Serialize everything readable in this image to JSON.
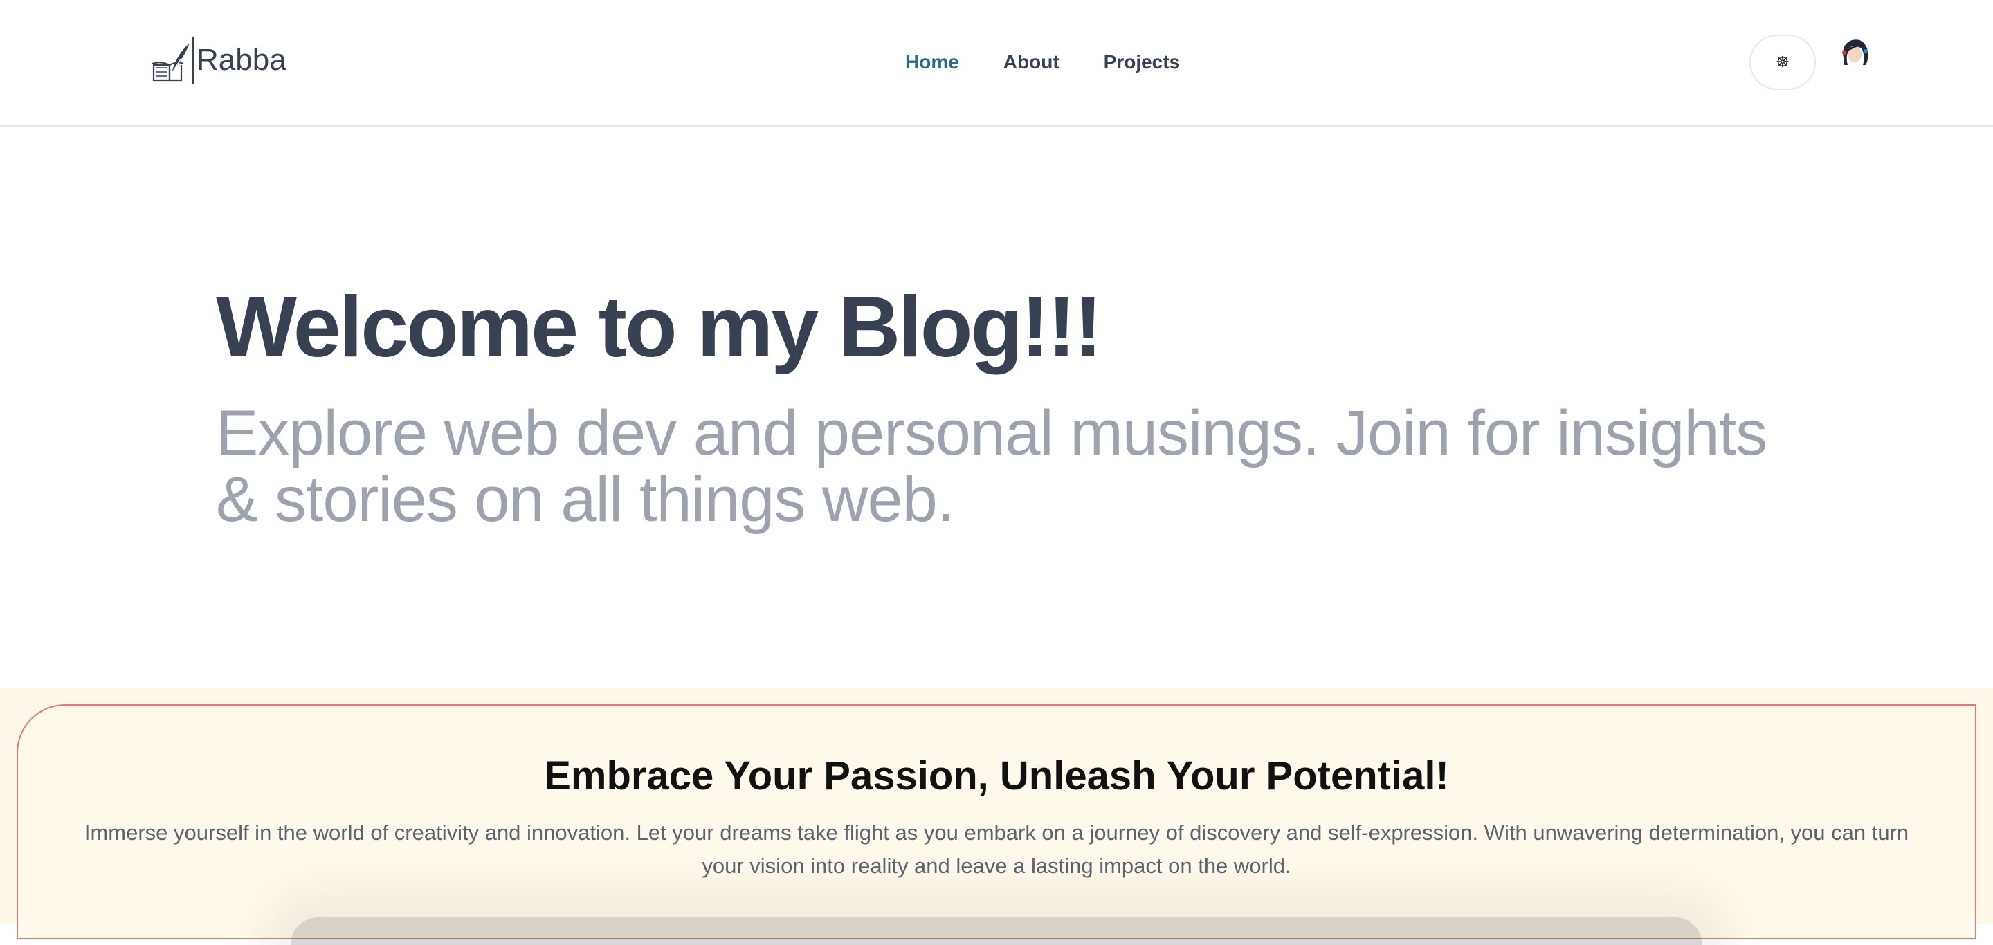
{
  "brand": {
    "name": "Rabba",
    "icon": "book-quill-icon"
  },
  "nav": {
    "items": [
      {
        "label": "Home",
        "active": true
      },
      {
        "label": "About",
        "active": false
      },
      {
        "label": "Projects",
        "active": false
      }
    ]
  },
  "header_actions": {
    "theme_toggle_glyph": "☸",
    "avatar_icon": "user-avatar"
  },
  "hero": {
    "title": "Welcome to my Blog!!!",
    "subtitle": "Explore web dev and personal musings. Join for insights & stories on all things web."
  },
  "banner": {
    "title": "Embrace Your Passion, Unleash Your Potential!",
    "text": "Immerse yourself in the world of creativity and innovation. Let your dreams take flight as you embark on a journey of discovery and self-expression. With unwavering determination, you can turn your vision into reality and leave a lasting impact on the world."
  },
  "colors": {
    "text": "#374151",
    "muted": "#9ca3af",
    "accent": "#2b6c87",
    "banner_bg": "#fdf8ea",
    "banner_border": "#e07a7a"
  }
}
